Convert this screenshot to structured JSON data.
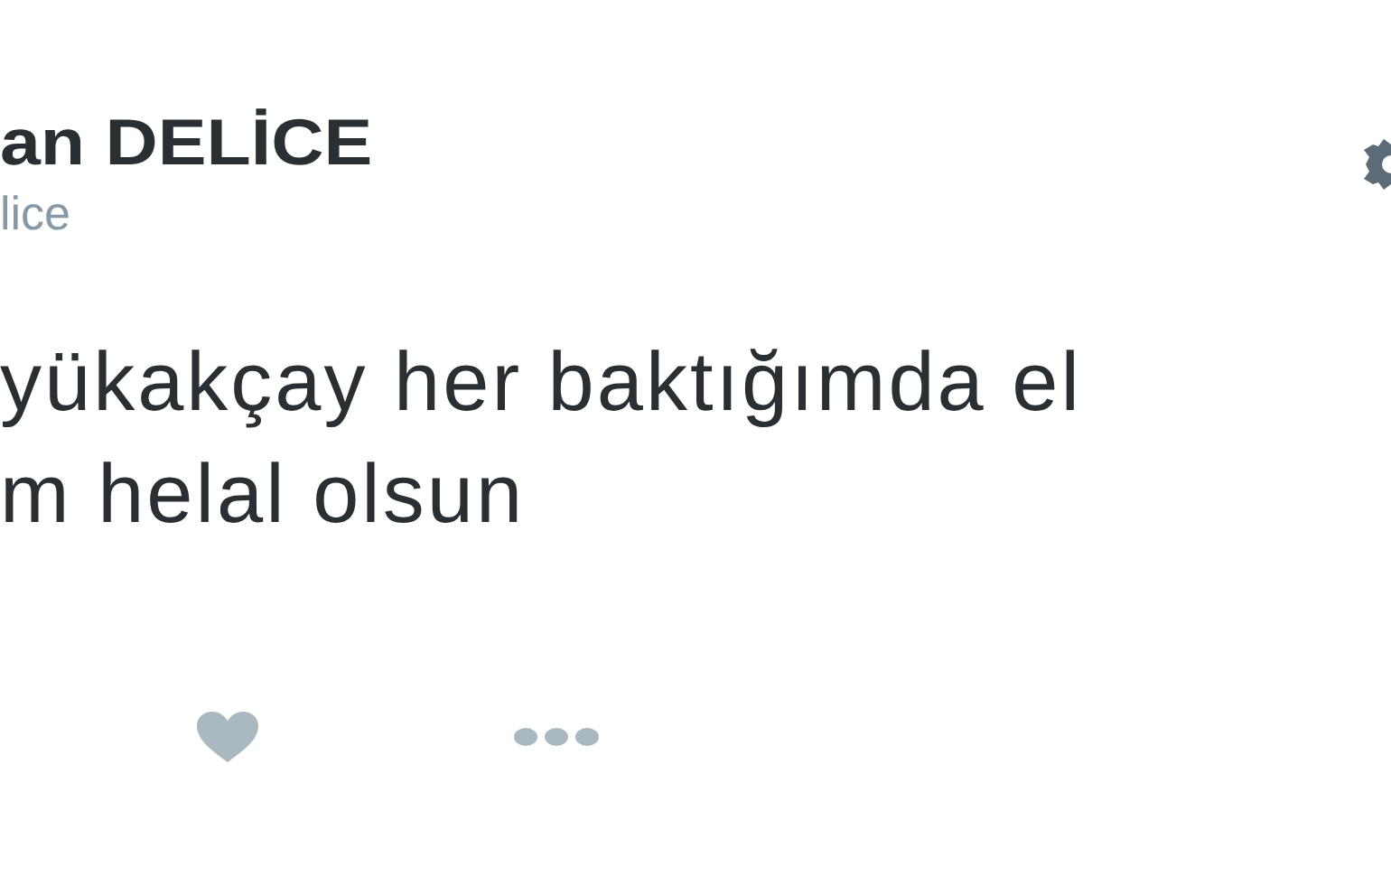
{
  "tweet": {
    "author_name": "an DELİCE",
    "handle": "lice",
    "text_lines": [
      "yükakçay her baktığımda el",
      "m helal olsun"
    ]
  }
}
